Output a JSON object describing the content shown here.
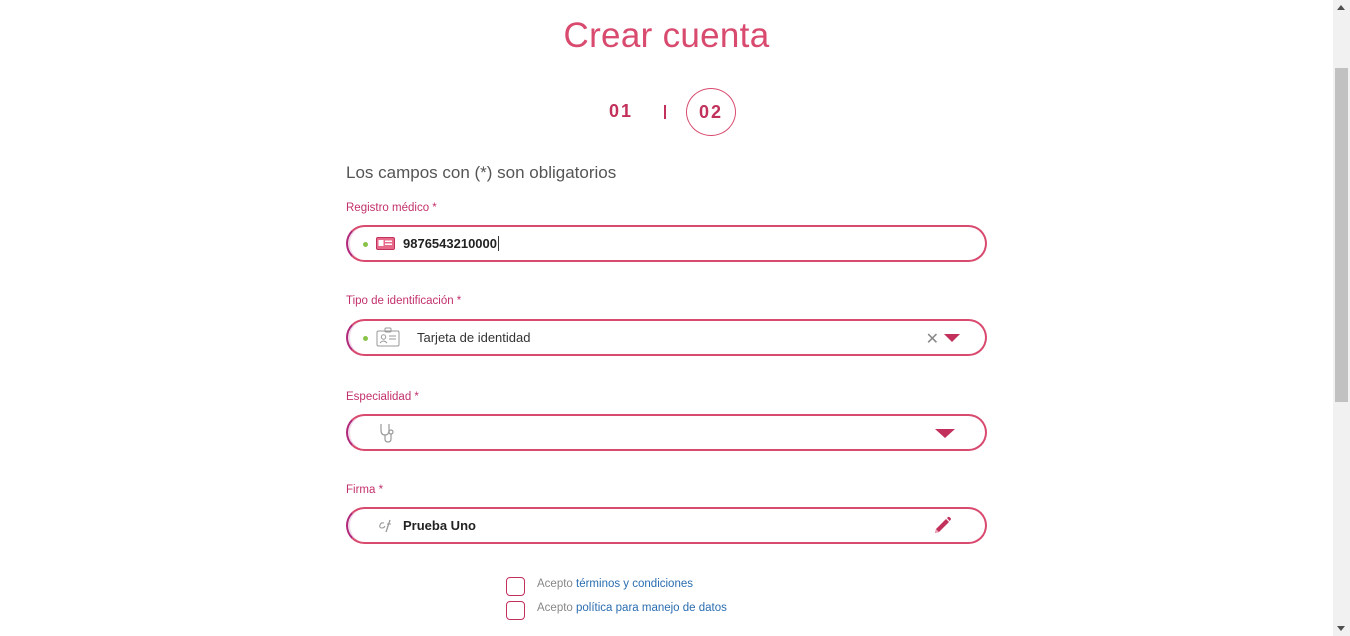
{
  "title": "Crear cuenta",
  "steps": {
    "step1": "01",
    "step2": "02"
  },
  "hint": "Los campos con (*) son obligatorios",
  "fields": {
    "medical_record": {
      "label": "Registro médico *",
      "value": "9876543210000",
      "icon": "id-card-icon"
    },
    "id_type": {
      "label": "Tipo de identificación *",
      "value": "Tarjeta de identidad",
      "icon": "id-badge-icon"
    },
    "specialty": {
      "label": "Especialidad *",
      "value": "",
      "icon": "stethoscope-icon"
    },
    "signature": {
      "label": "Firma *",
      "value": "Prueba Uno",
      "icon": "signature-icon"
    }
  },
  "checks": {
    "terms": {
      "prefix": "Acepto",
      "link": "términos y condiciones"
    },
    "privacy": {
      "prefix": "Acepto",
      "link": "política para manejo de datos"
    }
  },
  "colors": {
    "accent": "#d94a6f",
    "accent_dark": "#c2305c",
    "valid": "#8bc34a",
    "link": "#2a6db0"
  }
}
